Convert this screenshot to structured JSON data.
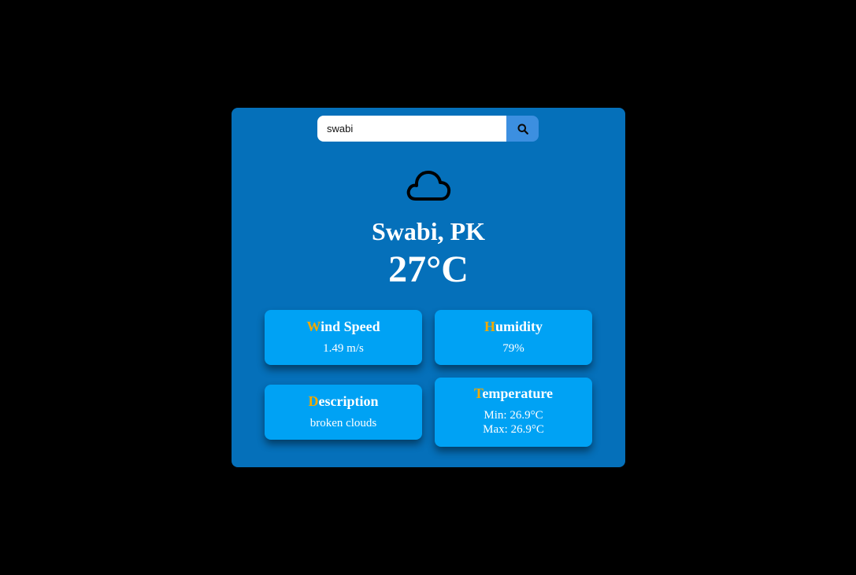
{
  "search": {
    "value": "swabi",
    "icon": "search-icon"
  },
  "weather": {
    "icon": "cloud-icon",
    "city": "Swabi, PK",
    "temperature": "27°C"
  },
  "cards": {
    "wind": {
      "title_first": "W",
      "title_rest": "ind Speed",
      "value": "1.49 m/s"
    },
    "humidity": {
      "title_first": "H",
      "title_rest": "umidity",
      "value": "79%"
    },
    "description": {
      "title_first": "D",
      "title_rest": "escription",
      "value": "broken clouds"
    },
    "temperature": {
      "title_first": "T",
      "title_rest": "emperature",
      "min": "Min: 26.9°C",
      "max": "Max: 26.9°C"
    }
  },
  "colors": {
    "background": "#000000",
    "panel": "#0570ba",
    "card": "#00a2f4",
    "accent_letter": "#f2a900",
    "search_button": "#3c8fe0"
  }
}
